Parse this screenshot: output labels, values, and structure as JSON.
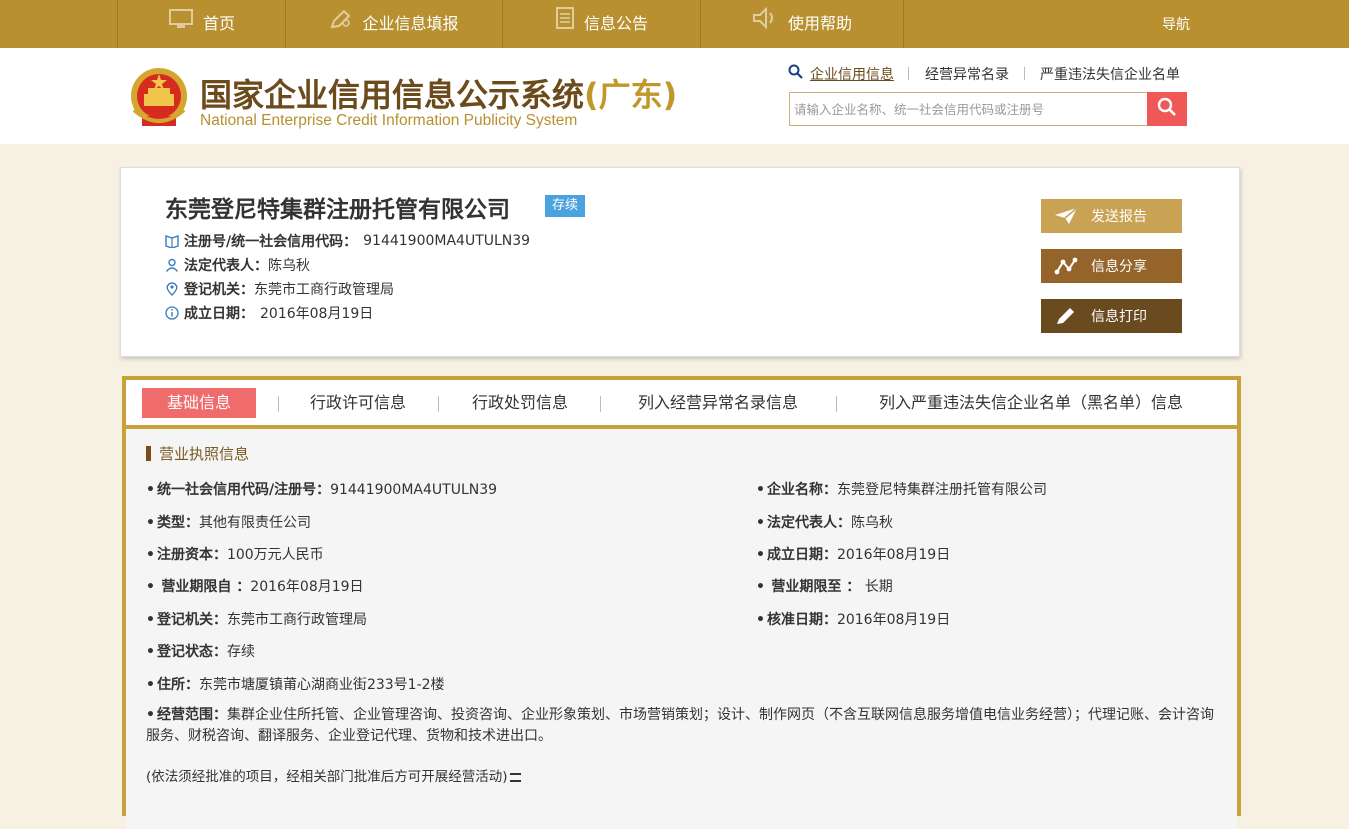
{
  "nav": {
    "home": "首页",
    "fill": "企业信息填报",
    "notice": "信息公告",
    "help": "使用帮助",
    "guide": "导航"
  },
  "header": {
    "title_main": "国家企业信用信息公示系统",
    "title_region": "(广东)",
    "title_en": "National Enterprise Credit Information Publicity System",
    "links": [
      "企业信用信息",
      "经营异常名录",
      "严重违法失信企业名单"
    ],
    "search_placeholder": "请输入企业名称、统一社会信用代码或注册号"
  },
  "company": {
    "name": "东莞登尼特集群注册托管有限公司",
    "status": "存续",
    "reg_label": "注册号/统一社会信用代码：",
    "reg_value": "91441900MA4UTULN39",
    "rep_label": "法定代表人：",
    "rep_value": "陈乌秋",
    "auth_label": "登记机关：",
    "auth_value": "东莞市工商行政管理局",
    "date_label": "成立日期：",
    "date_value": "2016年08月19日"
  },
  "actions": {
    "send": "发送报告",
    "share": "信息分享",
    "print": "信息打印"
  },
  "tabs": [
    "基础信息",
    "行政许可信息",
    "行政处罚信息",
    "列入经营异常名录信息",
    "列入严重违法失信企业名单（黑名单）信息"
  ],
  "section": {
    "title": "营业执照信息",
    "fields": {
      "credit_code": {
        "label": "统一社会信用代码/注册号：",
        "value": "91441900MA4UTULN39"
      },
      "ent_name": {
        "label": "企业名称：",
        "value": "东莞登尼特集群注册托管有限公司"
      },
      "type": {
        "label": "类型：",
        "value": "其他有限责任公司"
      },
      "legal_rep": {
        "label": "法定代表人：",
        "value": "陈乌秋"
      },
      "capital": {
        "label": "注册资本：",
        "value": "100万元人民币"
      },
      "est_date": {
        "label": "成立日期：",
        "value": "2016年08月19日"
      },
      "term_from": {
        "label": "营业期限自 ：",
        "value": "2016年08月19日"
      },
      "term_to": {
        "label": "营业期限至 ：",
        "value": "长期"
      },
      "authority": {
        "label": "登记机关：",
        "value": "东莞市工商行政管理局"
      },
      "approve_date": {
        "label": "核准日期：",
        "value": "2016年08月19日"
      },
      "reg_status": {
        "label": "登记状态：",
        "value": "存续"
      },
      "address": {
        "label": "住所：",
        "value": "东莞市塘厦镇莆心湖商业街233号1-2楼"
      },
      "scope": {
        "label": "经营范围：",
        "value": "集群企业住所托管、企业管理咨询、投资咨询、企业形象策划、市场营销策划；设计、制作网页（不含互联网信息服务增值电信业务经营）；代理记账、会计咨询服务、财税咨询、翻译服务、企业登记代理、货物和技术进出口。"
      }
    },
    "note": "(依法须经批准的项目，经相关部门批准后方可开展经营活动)"
  },
  "colors": {
    "nav_bg": "#b8902f",
    "brand_brown": "#6b4a1b",
    "tab_active": "#f06b6b",
    "badge": "#4aa3df",
    "btn_send": "#c9a253",
    "btn_share": "#94642a",
    "btn_print": "#6a4a1f",
    "search_btn": "#f05757"
  }
}
